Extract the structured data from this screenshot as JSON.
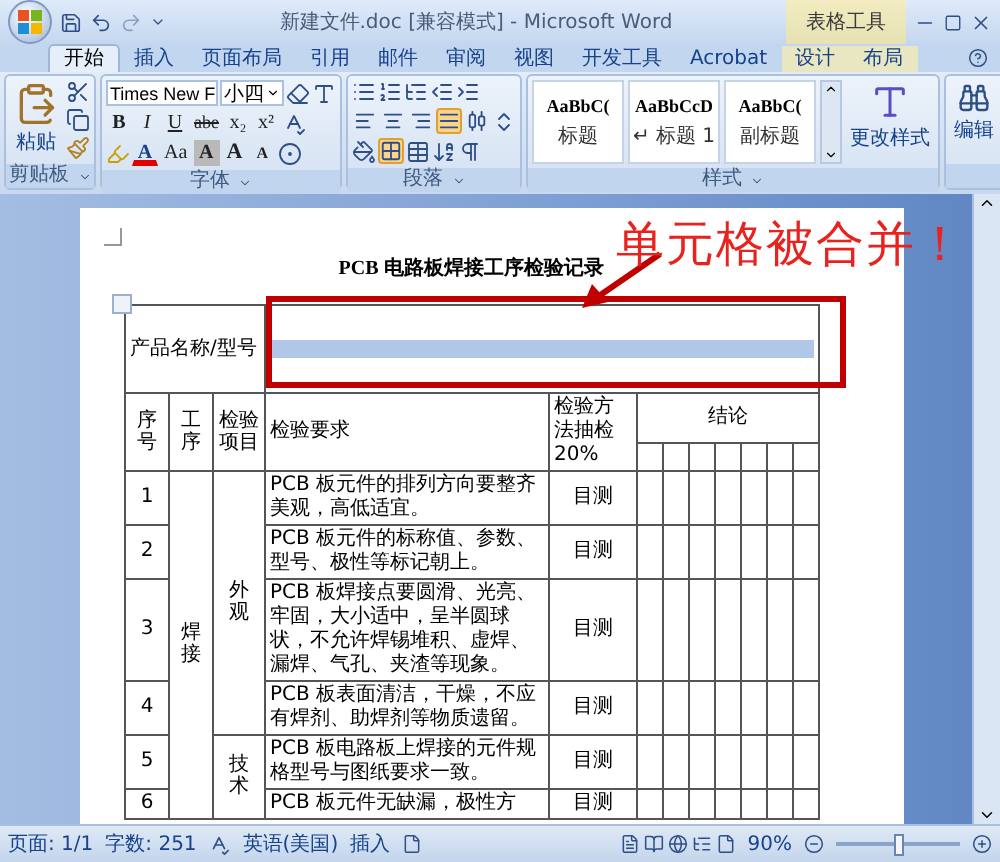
{
  "window": {
    "title": "新建文件.doc [兼容模式] - Microsoft Word",
    "context_label": "表格工具"
  },
  "tabs": [
    {
      "label": "开始",
      "selected": true,
      "kind": "normal"
    },
    {
      "label": "插入",
      "selected": false,
      "kind": "normal"
    },
    {
      "label": "页面布局",
      "selected": false,
      "kind": "normal"
    },
    {
      "label": "引用",
      "selected": false,
      "kind": "normal"
    },
    {
      "label": "邮件",
      "selected": false,
      "kind": "normal"
    },
    {
      "label": "审阅",
      "selected": false,
      "kind": "normal"
    },
    {
      "label": "视图",
      "selected": false,
      "kind": "normal"
    },
    {
      "label": "开发工具",
      "selected": false,
      "kind": "normal"
    },
    {
      "label": "Acrobat",
      "selected": false,
      "kind": "normal"
    },
    {
      "label": "设计",
      "selected": false,
      "kind": "contextual"
    },
    {
      "label": "布局",
      "selected": false,
      "kind": "contextual"
    }
  ],
  "ribbon": {
    "clipboard": {
      "label": "剪贴板",
      "paste": "粘贴"
    },
    "font": {
      "label": "字体",
      "font_name": "Times New F",
      "font_size": "小四",
      "style_buttons": [
        {
          "text": "B",
          "kind": "bold"
        },
        {
          "text": "I",
          "kind": "italic"
        },
        {
          "text": "U",
          "kind": "underline"
        },
        {
          "text": "abe",
          "kind": "strike"
        },
        {
          "text": "x₂",
          "kind": "plain"
        },
        {
          "text": "x²",
          "kind": "plain"
        }
      ],
      "effect_buttons": [
        {
          "text": "A",
          "kind": "color"
        },
        {
          "text": "Aa",
          "kind": "plain"
        },
        {
          "text": "A",
          "kind": "shade"
        },
        {
          "text": "A",
          "kind": "grow"
        },
        {
          "text": "A",
          "kind": "shrink"
        }
      ]
    },
    "paragraph": {
      "label": "段落",
      "alignment_buttons": [
        {
          "selected": false
        },
        {
          "selected": false
        },
        {
          "selected": false
        },
        {
          "selected": true
        },
        {
          "selected": false
        }
      ],
      "border_button": {
        "selected": true
      }
    },
    "styles": {
      "label": "样式",
      "items": [
        {
          "preview": "AaBbC(",
          "name": "标题"
        },
        {
          "preview": "AaBbCcD",
          "name": "↵ 标题 1"
        },
        {
          "preview": "AaBbC(",
          "name": "副标题"
        }
      ],
      "change": "更改样式"
    },
    "editing": {
      "label": "编辑"
    }
  },
  "document": {
    "title": "PCB 电路板焊接工序检验记录",
    "table": {
      "product_label": "产品名称/型号",
      "merged_cell": {
        "selected": true
      },
      "headers": {
        "no": "序号",
        "process": "工序",
        "item": "检验项目",
        "requirement": "检验要求",
        "method": "检验方法抽检20%",
        "result": "结论"
      },
      "process_groups": [
        {
          "label": "焊接",
          "items": [
            {
              "label": "外观",
              "rows": [
                {
                  "no": "1",
                  "requirement": "PCB 板元件的排列方向要整齐美观，高低适宜。",
                  "method": "目测"
                },
                {
                  "no": "2",
                  "requirement": "PCB 板元件的标称值、参数、型号、极性等标记朝上。",
                  "method": "目测"
                },
                {
                  "no": "3",
                  "requirement": "PCB 板焊接点要圆滑、光亮、牢固，大小适中，呈半圆球状，不允许焊锡堆积、虚焊、漏焊、气孔、夹渣等现象。",
                  "method": "目测"
                },
                {
                  "no": "4",
                  "requirement": "PCB 板表面清洁，干燥，不应有焊剂、助焊剂等物质遗留。",
                  "method": "目测"
                }
              ]
            },
            {
              "label": "技术",
              "rows": [
                {
                  "no": "5",
                  "requirement": "PCB 板电路板上焊接的元件规格型号与图纸要求一致。",
                  "method": "目测"
                },
                {
                  "no": "6",
                  "requirement": "PCB 板元件无缺漏，极性方",
                  "method": "目测"
                }
              ]
            }
          ]
        }
      ]
    }
  },
  "annotation": {
    "text": "单元格被合并！"
  },
  "status_bar": {
    "page": "页面: 1/1",
    "words": "字数: 251",
    "language": "英语(美国)",
    "mode": "插入",
    "zoom": "90%",
    "zoom_slider": {
      "level": 0.5
    }
  }
}
